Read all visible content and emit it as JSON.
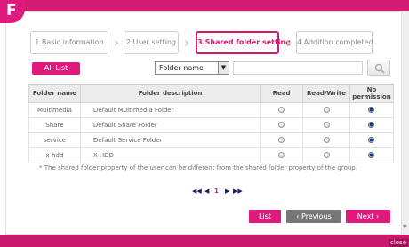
{
  "badge": "F",
  "steps": [
    {
      "label": "1.Basic information",
      "active": false
    },
    {
      "label": "2.User setting",
      "active": false
    },
    {
      "label": "3.Shared folder setting",
      "active": true
    },
    {
      "label": "4.Addition completed",
      "active": false
    }
  ],
  "toolbar": {
    "all_list_label": "All List",
    "search_field_value": "Folder name",
    "search_placeholder": ""
  },
  "table": {
    "columns": [
      "Folder name",
      "Folder description",
      "Read",
      "Read/Write",
      "No permission"
    ],
    "rows": [
      {
        "name": "Multimedia",
        "description": "Default Multimedia Folder",
        "permission": "No permission"
      },
      {
        "name": "Share",
        "description": "Default Share Folder",
        "permission": "No permission"
      },
      {
        "name": "service",
        "description": "Default Service Folder",
        "permission": "No permission"
      },
      {
        "name": "x-hdd",
        "description": "X-HDD",
        "permission": "No permission"
      }
    ]
  },
  "note": "* The shared folder property of the user can be different from the shared folder property of the group.",
  "pager": {
    "first": "◀◀",
    "prev": "◀",
    "current": "1",
    "next": "▶",
    "last": "▶▶"
  },
  "buttons": {
    "list": "List",
    "previous": "‹ Previous",
    "next": "Next ›"
  },
  "footer": {
    "close_label": "close"
  },
  "colors": {
    "accent": "#e0197d",
    "secondary_button": "#777777"
  }
}
